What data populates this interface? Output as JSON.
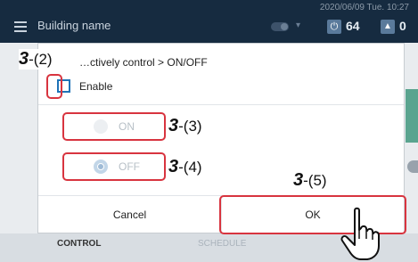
{
  "header": {
    "building_name": "Building name",
    "datetime": "2020/06/09 Tue. 10:27",
    "on_count": "64",
    "warning_count": "0",
    "power_icon": "power-icon",
    "warning_icon": "warning-icon"
  },
  "dialog": {
    "title": "…ctively control > ON/OFF",
    "enable_label": "Enable",
    "enable_checked": false,
    "options": [
      {
        "label": "ON",
        "selected": false
      },
      {
        "label": "OFF",
        "selected": true
      }
    ],
    "cancel_label": "Cancel",
    "ok_label": "OK"
  },
  "tabs": {
    "control": "CONTROL",
    "schedule": "SCHEDULE"
  },
  "annotations": {
    "step_num": "3",
    "s2": "-(2)",
    "s3": "-(3)",
    "s4": "-(4)",
    "s5": "-(5)"
  },
  "colors": {
    "header_bg": "#162b40",
    "highlight": "#d8343f",
    "checkbox": "#1f73b7"
  }
}
